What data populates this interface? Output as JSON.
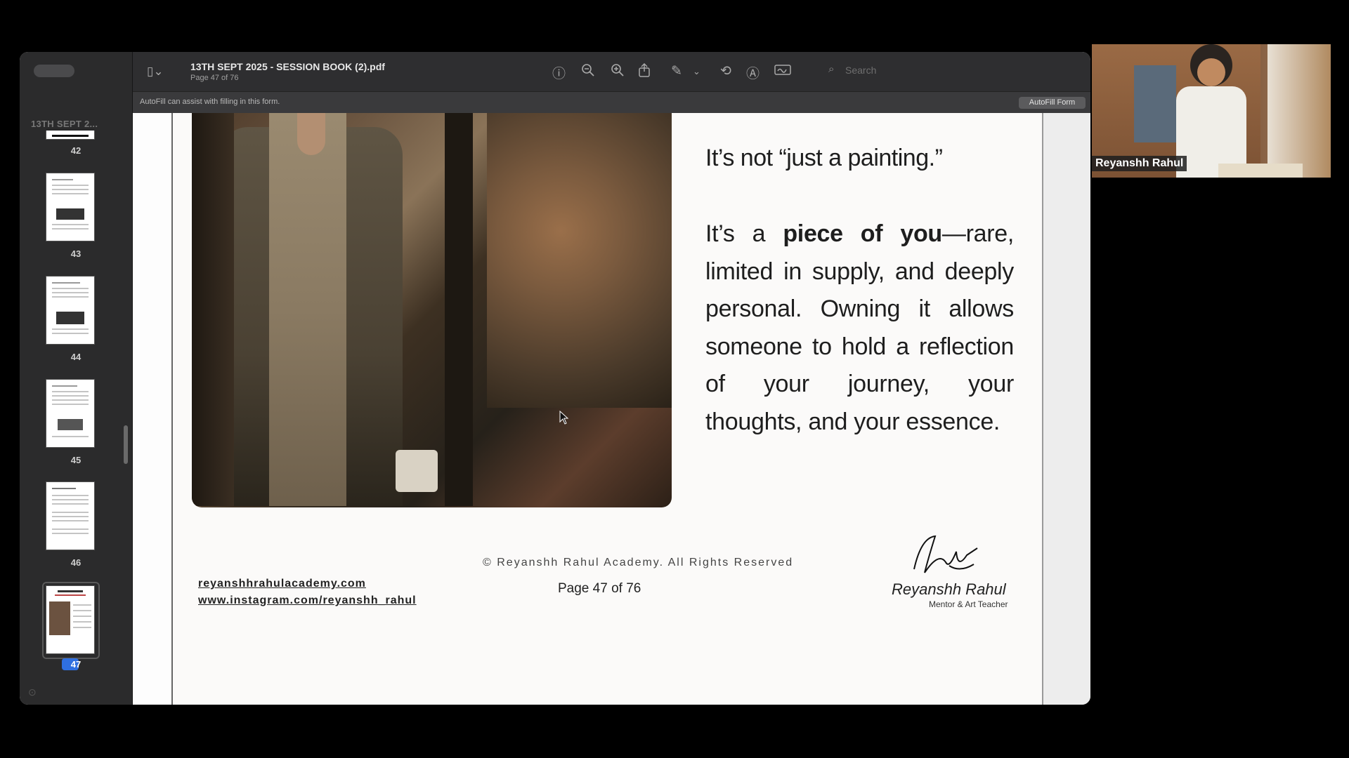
{
  "window": {
    "title": "13TH SEPT 2025 - SESSION BOOK (2).pdf",
    "subtitle": "Page 47 of 76"
  },
  "sidebar": {
    "title": "13TH SEPT 2...",
    "thumbnails": [
      {
        "label": "42"
      },
      {
        "label": "43"
      },
      {
        "label": "44"
      },
      {
        "label": "45"
      },
      {
        "label": "46"
      },
      {
        "label": "47",
        "selected": true
      }
    ]
  },
  "toolbar": {
    "icons": [
      "sidebar-toggle-icon",
      "info-icon",
      "zoom-out-icon",
      "zoom-in-icon",
      "share-icon",
      "markup-pen-icon",
      "chevron-down-icon",
      "rotate-icon",
      "annotate-icon",
      "sign-icon",
      "search-icon"
    ],
    "search_placeholder": "Search"
  },
  "autofill": {
    "message": "AutoFill can assist with filling in this form.",
    "button": "AutoFill Form"
  },
  "page": {
    "quote": "It’s not “just a painting.”",
    "para_start": "It’s a ",
    "para_bold": "piece of you",
    "para_rest": "—rare, limited in supply, and deeply personal. Owning it allows someone to hold a reflection of your journey, your thoughts, and your essence.",
    "copyright": "© Reyanshh Rahul Academy. All Rights Reserved",
    "link_website": "reyanshhrahulacademy.com",
    "link_instagram": "www.instagram.com/reyanshh_rahul",
    "page_number": "Page 47 of 76",
    "author_name": "Reyanshh Rahul",
    "author_role": "Mentor & Art Teacher"
  },
  "video": {
    "participant_name": "Reyanshh Rahul"
  },
  "colors": {
    "selection_blue": "#2f6fe0",
    "toolbar_bg": "#2e2e30",
    "sidebar_bg": "#2b2b2c"
  }
}
